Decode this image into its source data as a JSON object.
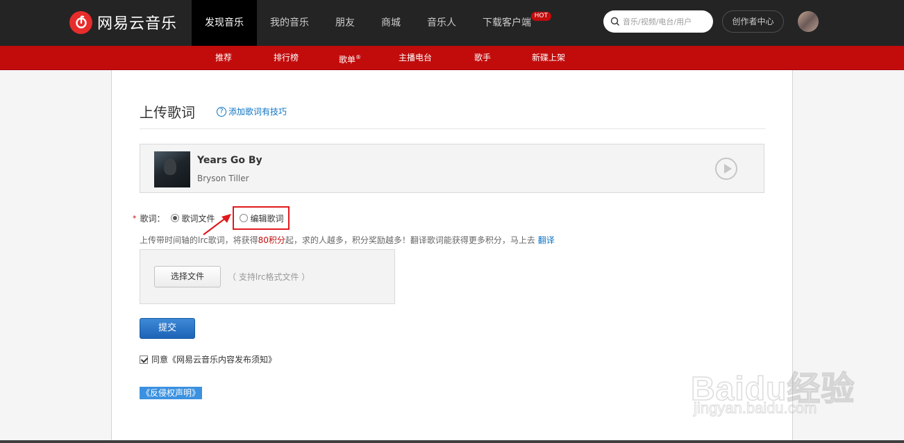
{
  "header": {
    "logo_text": "网易云音乐",
    "nav": [
      {
        "label": "发现音乐",
        "active": true
      },
      {
        "label": "我的音乐"
      },
      {
        "label": "朋友"
      },
      {
        "label": "商城"
      },
      {
        "label": "音乐人"
      },
      {
        "label": "下载客户端"
      }
    ],
    "hot_badge": "HOT",
    "search_placeholder": "音乐/视频/电台/用户",
    "creator_button": "创作者中心"
  },
  "subnav": {
    "items": [
      {
        "label": "推荐"
      },
      {
        "label": "排行榜"
      },
      {
        "label": "歌单",
        "sup": "®"
      },
      {
        "label": "主播电台"
      },
      {
        "label": "歌手"
      },
      {
        "label": "新碟上架"
      }
    ]
  },
  "page": {
    "title": "上传歌词",
    "tip": "添加歌词有技巧",
    "song": {
      "name": "Years Go By",
      "artist": "Bryson Tiller"
    },
    "lyrics_label": "歌词：",
    "required_mark": "*",
    "option_file": "歌词文件",
    "option_edit": "编辑歌词",
    "hint_pre": "上传带时间轴的lrc歌词，将获得",
    "hint_points": "80积分",
    "hint_mid": "起，求的人越多，积分奖励越多！翻译歌词能获得更多积分，马上去",
    "hint_link": "翻译",
    "choose_file": "选择文件",
    "file_hint": "（ 支持lrc格式文件 ）",
    "submit": "提交",
    "agree_text": "同意《网易云音乐内容发布须知》",
    "rights": "《反侵权声明》"
  },
  "watermark": {
    "brand": "Baidu经验",
    "url": "jingyan.baidu.com"
  },
  "colors": {
    "brand_red": "#c20c0c",
    "topbar": "#242424",
    "link_blue": "#0c73c2",
    "annotation_red": "#e0181b"
  }
}
